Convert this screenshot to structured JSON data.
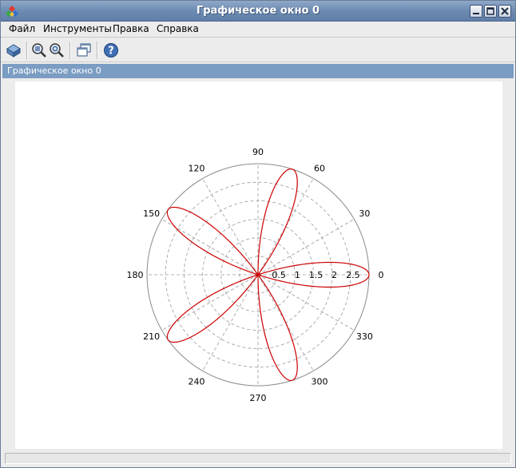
{
  "window": {
    "title": "Графическое окно 0"
  },
  "menu": {
    "items": [
      "Файл",
      "Инструменты",
      "Правка",
      "Справка"
    ]
  },
  "panel": {
    "header": "Графическое окно 0"
  },
  "toolbar": {
    "icons": [
      "rotate-icon",
      "zoom-in-icon",
      "zoom-reset-icon",
      "new-window-icon",
      "help-icon"
    ]
  },
  "colors": {
    "curve": "#cc0000",
    "grid": "#9a9a9a",
    "panel_header": "#7b9cc3"
  },
  "chart_data": {
    "type": "polar-line",
    "function": "r = 3*cos(5*theta)",
    "amplitude": 3,
    "petals": 5,
    "r_max": 3,
    "radial_ticks": [
      "0.5",
      "1",
      "1.5",
      "2",
      "2.5"
    ],
    "radial_tick_values": [
      0.5,
      1,
      1.5,
      2,
      2.5
    ],
    "angle_ticks": [
      "0",
      "30",
      "60",
      "90",
      "120",
      "150",
      "180",
      "210",
      "240",
      "270",
      "300",
      "330"
    ],
    "grid": true,
    "grid_style": "dashed"
  }
}
